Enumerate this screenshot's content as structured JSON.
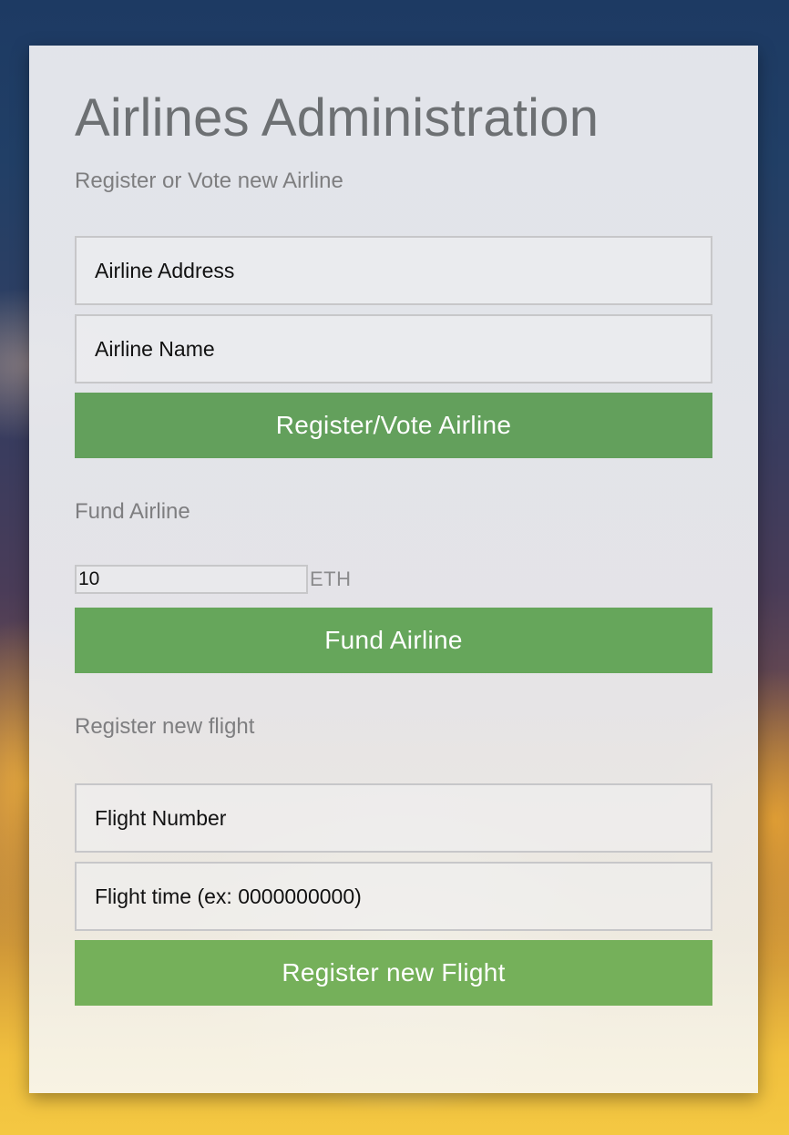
{
  "panel": {
    "title": "Airlines Administration"
  },
  "register_airline": {
    "section_label": "Register or Vote new Airline",
    "address_placeholder": "Airline Address",
    "name_placeholder": "Airline Name",
    "button_label": "Register/Vote Airline"
  },
  "fund_airline": {
    "section_label": "Fund Airline",
    "amount_value": "10",
    "unit": "ETH",
    "button_label": "Fund Airline"
  },
  "register_flight": {
    "section_label": "Register new flight",
    "flight_number_placeholder": "Flight Number",
    "flight_time_placeholder": "Flight time (ex: 0000000000)",
    "button_label": "Register new Flight"
  },
  "colors": {
    "button_green": "#63a05c",
    "title_gray": "#6d7073",
    "label_gray": "#7e7e80"
  }
}
